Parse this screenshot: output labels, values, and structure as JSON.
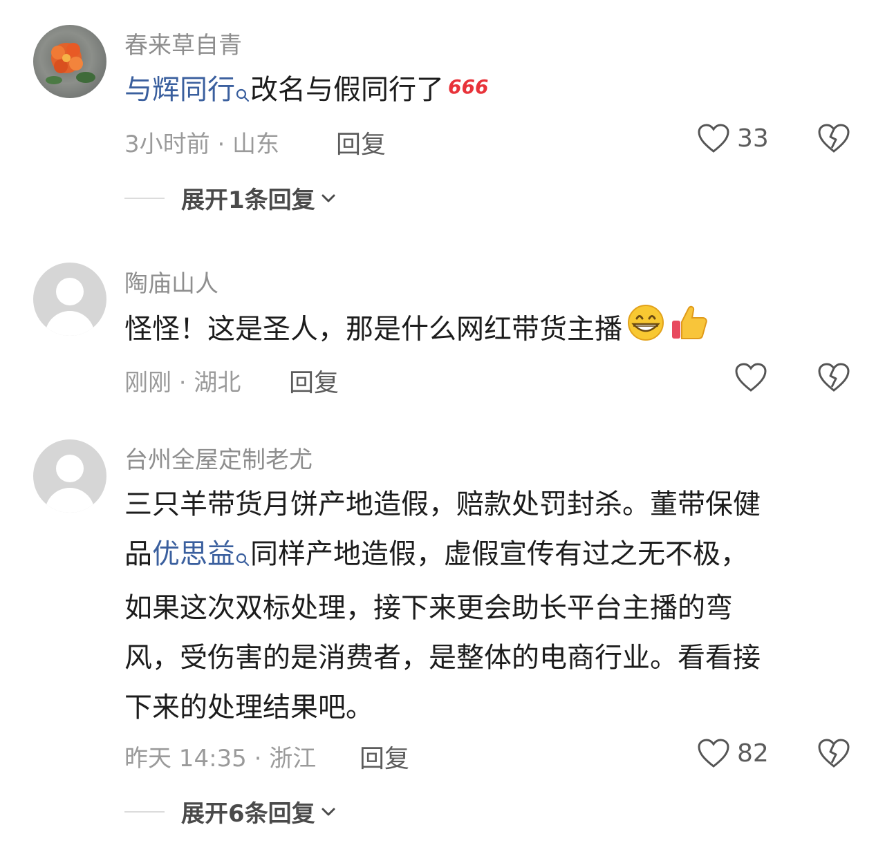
{
  "comments": [
    {
      "username": "春来草自青",
      "avatar": "flower-photo",
      "mention": "与辉同行",
      "text_after_mention": "改名与假同行了",
      "sticker": "666",
      "time_location": "3小时前 · 山东",
      "reply_label": "回复",
      "likes": "33",
      "expand_label": "展开1条回复"
    },
    {
      "username": "陶庙山人",
      "avatar": "default",
      "text": "怪怪！这是圣人，那是什么网红带货主播",
      "emojis": [
        "grinning-face",
        "thumbs-up"
      ],
      "time_location": "刚刚 · 湖北",
      "reply_label": "回复",
      "likes": ""
    },
    {
      "username": "台州全屋定制老尤",
      "avatar": "default",
      "text_line1": "三只羊带货月饼产地造假，赔款处罚封杀。董带保健",
      "text_line2_before": "品",
      "mention": "优思益",
      "text_line2_after": "同样产地造假，虚假宣传有过之无不极，",
      "text_line3": "如果这次双标处理，接下来更会助长平台主播的弯",
      "text_line4": "风，受伤害的是消费者，是整体的电商行业。看看接",
      "text_line5": "下来的处理结果吧。",
      "time_location": "昨天 14:35 · 浙江",
      "reply_label": "回复",
      "likes": "82",
      "expand_label": "展开6条回复"
    }
  ],
  "colors": {
    "mention": "#3a5f9e",
    "meta_gray": "#9a9a9a",
    "username_gray": "#8e8e8e"
  }
}
